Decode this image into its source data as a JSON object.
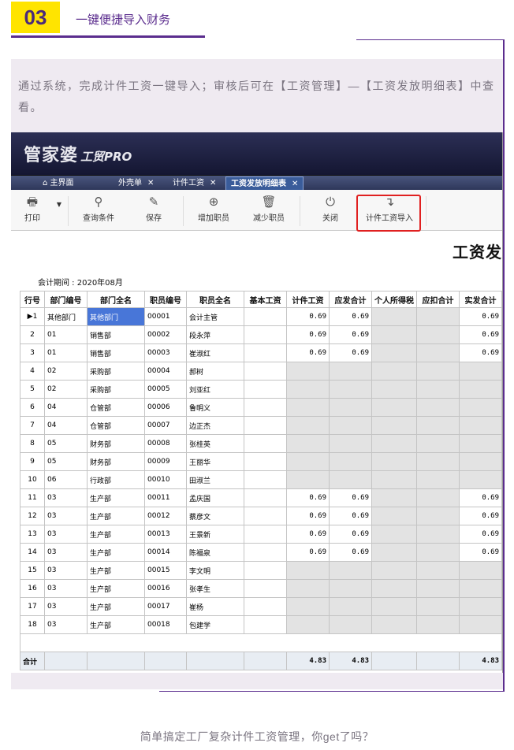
{
  "header": {
    "number": "03",
    "title": "一键便捷导入财务"
  },
  "intro": "通过系统，完成计件工资一键导入；审核后可在【工资管理】—【工资发放明细表】中查看。",
  "app": {
    "logo": "管家婆",
    "logo_sub": "工贸PRO"
  },
  "tabs": [
    {
      "label": "主界面",
      "icon": "home-icon"
    },
    {
      "label": "外壳单",
      "close": "✕"
    },
    {
      "label": "计件工资",
      "close": "✕"
    },
    {
      "label": "工资发放明细表",
      "close": "✕",
      "active": true
    }
  ],
  "toolbar": [
    {
      "label": "打印",
      "icon": "printer-icon"
    },
    {
      "label": "查询条件",
      "icon": "search-icon"
    },
    {
      "label": "保存",
      "icon": "save-icon"
    },
    {
      "label": "增加职员",
      "icon": "add-icon"
    },
    {
      "label": "减少职员",
      "icon": "trash-icon"
    },
    {
      "label": "关闭",
      "icon": "power-icon"
    },
    {
      "label": "计件工资导入",
      "icon": "import-arrow-icon"
    }
  ],
  "report_title": "工资发",
  "period": "会计期间 : 2020年08月",
  "columns": [
    "行号",
    "部门编号",
    "部门全名",
    "职员编号",
    "职员全名",
    "基本工资",
    "计件工资",
    "应发合计",
    "个人所得税",
    "应扣合计",
    "实发合计"
  ],
  "rows": [
    [
      "1",
      "其他部门",
      "其他部门",
      "00001",
      "会计主管",
      "",
      "0.69",
      "0.69",
      "",
      "",
      "0.69"
    ],
    [
      "2",
      "01",
      "销售部",
      "00002",
      "段永萍",
      "",
      "0.69",
      "0.69",
      "",
      "",
      "0.69"
    ],
    [
      "3",
      "01",
      "销售部",
      "00003",
      "崔淑红",
      "",
      "0.69",
      "0.69",
      "",
      "",
      "0.69"
    ],
    [
      "4",
      "02",
      "采购部",
      "00004",
      "郝树",
      "",
      "",
      "",
      "",
      "",
      ""
    ],
    [
      "5",
      "02",
      "采购部",
      "00005",
      "刘亚红",
      "",
      "",
      "",
      "",
      "",
      ""
    ],
    [
      "6",
      "04",
      "仓管部",
      "00006",
      "鲁明义",
      "",
      "",
      "",
      "",
      "",
      ""
    ],
    [
      "7",
      "04",
      "仓管部",
      "00007",
      "边正杰",
      "",
      "",
      "",
      "",
      "",
      ""
    ],
    [
      "8",
      "05",
      "财务部",
      "00008",
      "张桂英",
      "",
      "",
      "",
      "",
      "",
      ""
    ],
    [
      "9",
      "05",
      "财务部",
      "00009",
      "王丽华",
      "",
      "",
      "",
      "",
      "",
      ""
    ],
    [
      "10",
      "06",
      "行政部",
      "00010",
      "田淑兰",
      "",
      "",
      "",
      "",
      "",
      ""
    ],
    [
      "11",
      "03",
      "生产部",
      "00011",
      "孟庆国",
      "",
      "0.69",
      "0.69",
      "",
      "",
      "0.69"
    ],
    [
      "12",
      "03",
      "生产部",
      "00012",
      "蔡彦文",
      "",
      "0.69",
      "0.69",
      "",
      "",
      "0.69"
    ],
    [
      "13",
      "03",
      "生产部",
      "00013",
      "王景新",
      "",
      "0.69",
      "0.69",
      "",
      "",
      "0.69"
    ],
    [
      "14",
      "03",
      "生产部",
      "00014",
      "陈福泉",
      "",
      "0.69",
      "0.69",
      "",
      "",
      "0.69"
    ],
    [
      "15",
      "03",
      "生产部",
      "00015",
      "李文明",
      "",
      "",
      "",
      "",
      "",
      ""
    ],
    [
      "16",
      "03",
      "生产部",
      "00016",
      "张孝生",
      "",
      "",
      "",
      "",
      "",
      ""
    ],
    [
      "17",
      "03",
      "生产部",
      "00017",
      "崔杨",
      "",
      "",
      "",
      "",
      "",
      ""
    ],
    [
      "18",
      "03",
      "生产部",
      "00018",
      "包建学",
      "",
      "",
      "",
      "",
      "",
      ""
    ]
  ],
  "totals": {
    "label": "合计",
    "piece_wage": "4.83",
    "gross": "4.83",
    "net": "4.83"
  },
  "caption": "简单搞定工厂复杂计件工资管理，你get了吗？"
}
